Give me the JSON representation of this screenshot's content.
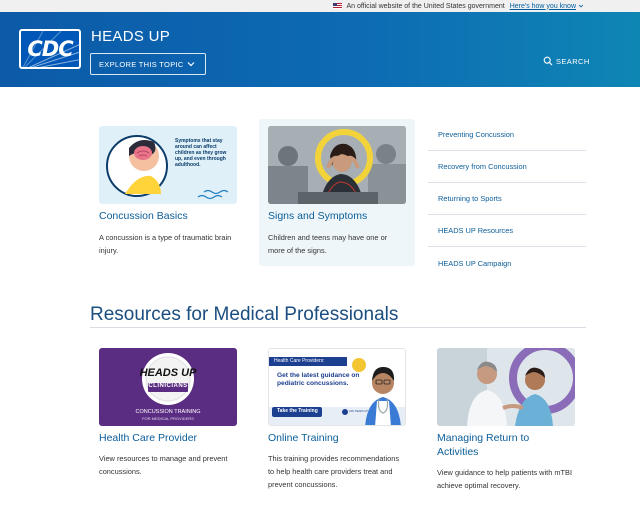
{
  "gov_banner": {
    "text": "An official website of the United States government",
    "link": "Here's how you know"
  },
  "header": {
    "logo": "CDC",
    "title": "HEADS UP",
    "explore_label": "EXPLORE THIS TOPIC",
    "search_label": "SEARCH"
  },
  "top_cards": [
    {
      "title": "Concussion Basics",
      "description": "A concussion is a type of traumatic brain injury.",
      "image_text": "Symptoms that stay around can affect children as they grow up, and even through adulthood."
    },
    {
      "title": "Signs and Symptoms",
      "description": "Children and teens may have one or more of the signs."
    }
  ],
  "side_links": [
    "Preventing Concussion",
    "Recovery from Concussion",
    "Returning to Sports",
    "HEADS UP Resources",
    "HEADS UP Campaign"
  ],
  "section": {
    "title": "Resources for Medical Professionals"
  },
  "resource_cards": [
    {
      "title": "Health Care Provider",
      "description": "View resources to manage and prevent concussions.",
      "badge_line1": "HEADS UP",
      "badge_line2": "CLINICIANS",
      "caption_line1": "CONCUSSION TRAINING",
      "caption_line2": "FOR MEDICAL PROVIDERS"
    },
    {
      "title": "Online Training",
      "description": "This training provides recommendations to help health care providers treat and prevent concussions.",
      "tag": "Health Care Providers:",
      "headline": "Get the latest guidance on pediatric concussions.",
      "button": "Take the Training",
      "brand": "CDC HEADS UP"
    },
    {
      "title": "Managing Return to Activities",
      "description": "View guidance to help patients with mTBI achieve optimal recovery."
    }
  ],
  "colors": {
    "header_start": "#0c5aa8",
    "header_end": "#0e86b4",
    "link": "#0b5d98",
    "section_title": "#1a4d80",
    "clinician_purple": "#5b2d82"
  }
}
